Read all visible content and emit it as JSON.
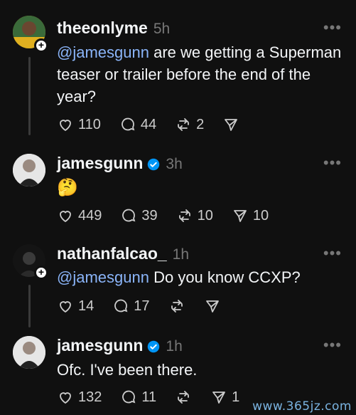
{
  "posts": [
    {
      "username": "theeonlyme",
      "time": "5h",
      "mention": "@jamesgunn",
      "text": " are we getting a Superman teaser or trailer before the end of the year?",
      "likes": "110",
      "replies": "44",
      "reposts": "2",
      "shares": ""
    },
    {
      "username": "jamesgunn",
      "time": "3h",
      "text": "🤔",
      "likes": "449",
      "replies": "39",
      "reposts": "10",
      "shares": "10"
    },
    {
      "username": "nathanfalcao_",
      "time": "1h",
      "mention": "@jamesgunn",
      "text": " Do you know CCXP?",
      "likes": "14",
      "replies": "17",
      "reposts": "",
      "shares": ""
    },
    {
      "username": "jamesgunn",
      "time": "1h",
      "text": "Ofc. I've been there.",
      "likes": "132",
      "replies": "11",
      "reposts": "",
      "shares": "1"
    }
  ],
  "more_glyph": "•••",
  "watermark": "www.365jz.com",
  "colors": {
    "background": "#101010",
    "mention": "#8ab4f8",
    "verified": "#0095f6"
  }
}
